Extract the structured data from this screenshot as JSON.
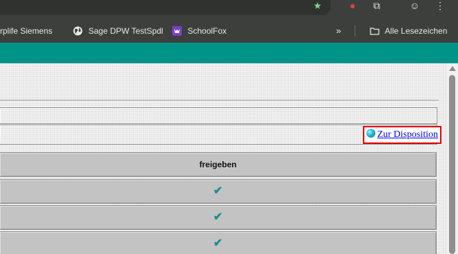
{
  "browser": {
    "bookmarks": [
      {
        "label": "rplife Siemens",
        "icon": "none"
      },
      {
        "label": "Sage DPW TestSpdl",
        "icon": "globe-icon"
      },
      {
        "label": "SchoolFox",
        "icon": "schoolfox-icon"
      }
    ],
    "overflow_icon": "»",
    "all_bookmarks_label": "Alle Lesezeichen",
    "colors": {
      "toolbar": "#3c3f3c",
      "header_teal": "#009488"
    }
  },
  "page": {
    "dispo_link": "Zur Disposition",
    "table": {
      "header": "freigeben",
      "rows": [
        "✔",
        "✔",
        "✔"
      ]
    },
    "colors": {
      "link": "#0000ee",
      "highlight_border": "#e00000",
      "check": "#1f8c88",
      "row_bg": "#c3c3c3"
    }
  }
}
